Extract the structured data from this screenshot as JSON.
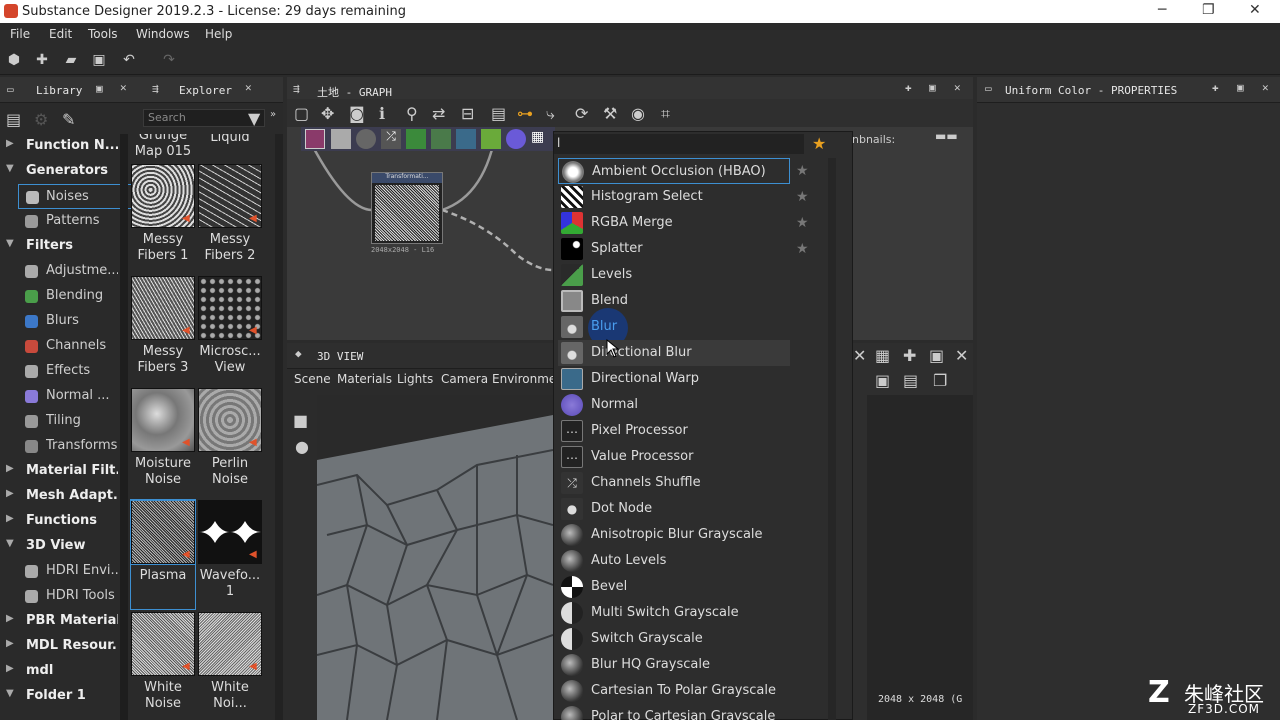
{
  "window": {
    "title": "Substance Designer 2019.2.3 - License: 29 days remaining",
    "minimize": "─",
    "maximize": "❐",
    "close": "✕"
  },
  "menu": [
    "File",
    "Edit",
    "Tools",
    "Windows",
    "Help"
  ],
  "library": {
    "tab_library": "Library",
    "tab_explorer": "Explorer",
    "search_placeholder": "Search",
    "tree": [
      {
        "type": "sec",
        "label": "Function N...",
        "open": false
      },
      {
        "type": "sec",
        "label": "Generators",
        "open": true
      },
      {
        "type": "itm",
        "label": "Noises",
        "icon": "#bbb",
        "selected": true
      },
      {
        "type": "itm",
        "label": "Patterns",
        "icon": "#9a9a9a"
      },
      {
        "type": "sec",
        "label": "Filters",
        "open": true
      },
      {
        "type": "itm",
        "label": "Adjustme...",
        "icon": "#aaa"
      },
      {
        "type": "itm",
        "label": "Blending",
        "icon": "#4a9e4a"
      },
      {
        "type": "itm",
        "label": "Blurs",
        "icon": "#3c78c8"
      },
      {
        "type": "itm",
        "label": "Channels",
        "icon": "#c84a3c"
      },
      {
        "type": "itm",
        "label": "Effects",
        "icon": "#aaa"
      },
      {
        "type": "itm",
        "label": "Normal ...",
        "icon": "#8a7ad8"
      },
      {
        "type": "itm",
        "label": "Tiling",
        "icon": "#999"
      },
      {
        "type": "itm",
        "label": "Transforms",
        "icon": "#888"
      },
      {
        "type": "sec",
        "label": "Material Filt...",
        "open": false
      },
      {
        "type": "sec",
        "label": "Mesh Adapt...",
        "open": false
      },
      {
        "type": "sec",
        "label": "Functions",
        "open": false
      },
      {
        "type": "sec",
        "label": "3D View",
        "open": true
      },
      {
        "type": "itm",
        "label": "HDRI Envi...",
        "icon": "#aaa"
      },
      {
        "type": "itm",
        "label": "HDRI Tools",
        "icon": "#aaa"
      },
      {
        "type": "sec",
        "label": "PBR Materials",
        "open": false
      },
      {
        "type": "sec",
        "label": "MDL Resour...",
        "open": false
      },
      {
        "type": "sec",
        "label": "mdl",
        "open": false
      },
      {
        "type": "sec",
        "label": "Folder 1",
        "open": true
      }
    ],
    "thumbs_top": {
      "a": "Grunge\nMap 015",
      "b": "Liquid"
    },
    "thumbs": [
      {
        "a": "Messy\nFibers 1",
        "b": "Messy\nFibers 2"
      },
      {
        "a": "Messy\nFibers 3",
        "b": "Microsc...\nView"
      },
      {
        "a": "Moisture\nNoise",
        "b": "Perlin\nNoise"
      },
      {
        "a": "Plasma",
        "b": "Wavefo...\n1"
      },
      {
        "a": "White\nNoise",
        "b": "White\nNoi..."
      }
    ]
  },
  "graph": {
    "title": "土地 - GRAPH",
    "node_title": "Transformati...",
    "node_res": "2048x2048 - L16",
    "thumbnails_label": "nbnails:"
  },
  "view3d": {
    "title": "3D VIEW",
    "menus": [
      "Scene",
      "Materials",
      "Lights",
      "Camera",
      "Environmen"
    ],
    "resolution": "2048 x 2048 (G"
  },
  "properties": {
    "title": "Uniform Color - PROPERTIES"
  },
  "popup": {
    "query": "l",
    "items": [
      {
        "label": "Ambient Occlusion (HBAO)",
        "icon": "hbao",
        "star": true,
        "state": "focused"
      },
      {
        "label": "Histogram Select",
        "icon": "hist",
        "star": true
      },
      {
        "label": "RGBA Merge",
        "icon": "rgba",
        "star": true
      },
      {
        "label": "Splatter",
        "icon": "splat",
        "star": true
      },
      {
        "label": "Levels",
        "icon": "levels"
      },
      {
        "label": "Blend",
        "icon": "blend"
      },
      {
        "label": "Blur",
        "icon": "drop",
        "state": "hover"
      },
      {
        "label": "Directional Blur",
        "icon": "drop",
        "state": "highlight"
      },
      {
        "label": "Directional Warp",
        "icon": "warp"
      },
      {
        "label": "Normal",
        "icon": "normal"
      },
      {
        "label": "Pixel Processor",
        "icon": "pixel"
      },
      {
        "label": "Value Processor",
        "icon": "value"
      },
      {
        "label": "Channels Shuffle",
        "icon": "shuffle"
      },
      {
        "label": "Dot Node",
        "icon": "dot"
      },
      {
        "label": "Anisotropic Blur Grayscale",
        "icon": "gray"
      },
      {
        "label": "Auto Levels",
        "icon": "gray"
      },
      {
        "label": "Bevel",
        "icon": "bevel"
      },
      {
        "label": "Multi Switch Grayscale",
        "icon": "half"
      },
      {
        "label": "Switch Grayscale",
        "icon": "half"
      },
      {
        "label": "Blur HQ Grayscale",
        "icon": "gray"
      },
      {
        "label": "Cartesian To Polar Grayscale",
        "icon": "gray"
      },
      {
        "label": "Polar to Cartesian Grayscale",
        "icon": "gray"
      }
    ]
  },
  "watermark": {
    "cn": "朱峰社区",
    "url": "ZF3D.COM"
  }
}
